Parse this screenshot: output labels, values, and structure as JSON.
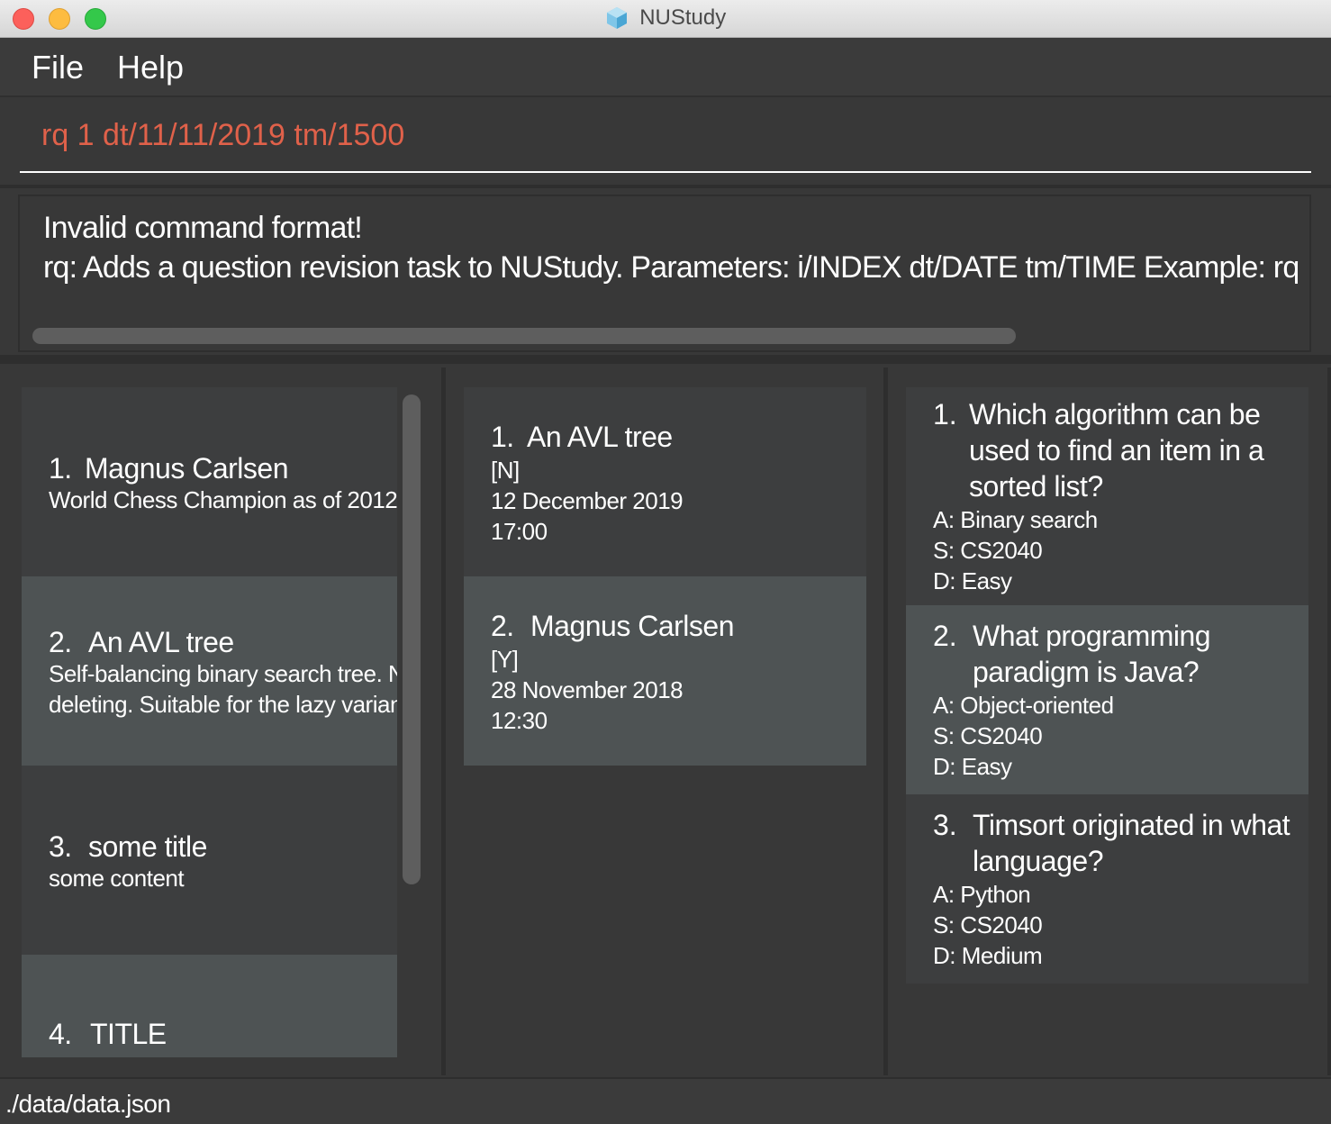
{
  "window": {
    "title": "NUStudy"
  },
  "menu": {
    "file_label": "File",
    "help_label": "Help"
  },
  "command": {
    "value": "rq 1 dt/11/11/2019 tm/1500"
  },
  "result": {
    "line1": "Invalid command format!",
    "line2": "rq: Adds a question revision task to NUStudy. Parameters: i/INDEX dt/DATE tm/TIME Example: rq"
  },
  "notes": [
    {
      "num": "1.",
      "title": "Magnus Carlsen",
      "content_line1": "World Chess Champion as of 2012",
      "content_line2": ""
    },
    {
      "num": "2.",
      "title": "An AVL tree",
      "content_line1": "Self-balancing binary search tree. N",
      "content_line2": "deleting. Suitable for the lazy variant"
    },
    {
      "num": "3.",
      "title": "some title",
      "content_line1": "some content",
      "content_line2": ""
    },
    {
      "num": "4.",
      "title": "TITLE",
      "content_line1": "",
      "content_line2": ""
    }
  ],
  "tasks": [
    {
      "num": "1.",
      "title": "An AVL tree",
      "status": "[N]",
      "date": "12 December 2019",
      "time": "17:00"
    },
    {
      "num": "2.",
      "title": "Magnus Carlsen",
      "status": "[Y]",
      "date": "28 November 2018",
      "time": "12:30"
    }
  ],
  "questions": [
    {
      "num": "1.",
      "title_lines": [
        "Which algorithm can be",
        "used to find an item in a",
        "sorted list?"
      ],
      "answer": "A: Binary search",
      "subject": "S: CS2040",
      "difficulty": "D: Easy"
    },
    {
      "num": "2.",
      "title_lines": [
        "What programming",
        "paradigm is Java?"
      ],
      "answer": "A: Object-oriented",
      "subject": "S: CS2040",
      "difficulty": "D: Easy"
    },
    {
      "num": "3.",
      "title_lines": [
        "Timsort originated in what",
        "language?"
      ],
      "answer": "A: Python",
      "subject": "S: CS2040",
      "difficulty": "D: Medium"
    }
  ],
  "status": {
    "path": "./data/data.json"
  },
  "colors": {
    "command_text": "#e0614a",
    "background": "#383838",
    "card_dark": "#3d3e3f",
    "card_light": "#4e5354"
  }
}
